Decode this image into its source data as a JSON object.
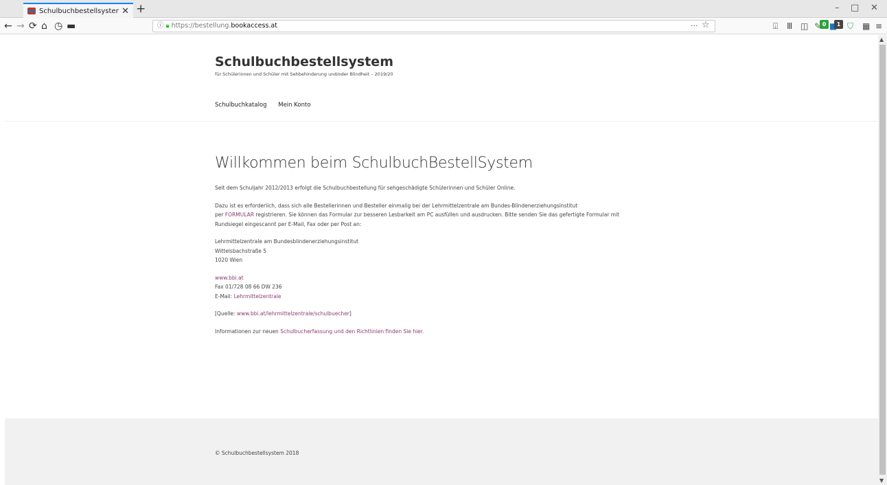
{
  "browser": {
    "tab_title": "Schulbuchbestellsystem – für Sc",
    "tab_close": "✕",
    "new_tab": "+",
    "url_scheme": "https://",
    "url_sub": "bestellung.",
    "url_host": "bookaccess.at",
    "url_more": "···",
    "url_star": "☆",
    "badges": [
      "0",
      "1"
    ],
    "win_minimize": "–",
    "win_maximize": "□",
    "win_close": "✕"
  },
  "site": {
    "title": "Schulbuchbestellsystem",
    "description": "für Schülerinnen und Schüler mit Sehbehinderung und/oder Blindheit – 2019/20",
    "menu": [
      "Schulbuchkatalog",
      "Mein Konto"
    ]
  },
  "content": {
    "heading": "Willkommen beim SchulbuchBestellSystem",
    "intro": "Seit dem Schuljahr 2012/2013 erfolgt die Schulbuchbestellung für sehgeschädigte Schülerinnen und Schüler Online.",
    "para2_a": "Dazu ist es erforderlich, dass sich alle Bestellerinnen und Besteller einmalig bei der Lehrmittelzentrale am Bundes-Blindenerziehungsinstitut",
    "para2_per": "per ",
    "para2_link": "FORMULAR",
    "para2_b": " registrieren. Sie können das Formular zur besseren Lesbarkeit am PC ausfüllen und ausdrucken. Bitte senden Sie das gefertigte Formular mit",
    "para2_c": "Rundsiegel eingescannt per E-Mail, Fax oder per Post an:",
    "address": [
      "Lehrmittelzentrale am Bundesblindenerziehungsinstitut",
      "Wittelsbachstraße 5",
      "1020 Wien"
    ],
    "web_link": "www.bbi.at",
    "fax": "Fax 01/728 08 66 DW 236",
    "email_label": "E-Mail: ",
    "email_link": "Lehrmittelzentrale",
    "source_open": "[Quelle: ",
    "source_link": "www.bbi.at/lehrmittelzentrale/schulbuecher",
    "source_close": "]",
    "info_text": "Informationen zur neuen ",
    "info_link": "Schulbucherfassung und den Richtlinien finden Sie hier."
  },
  "footer": {
    "copyright": "© Schulbuchbestellsystem 2018"
  },
  "colors": {
    "link": "#8c3c73",
    "tab_accent": "#0a84ff",
    "lock": "#12bc00"
  }
}
